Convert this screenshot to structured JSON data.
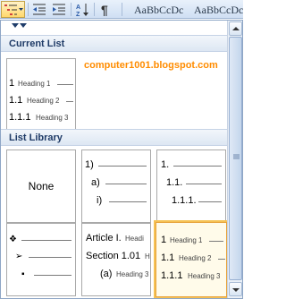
{
  "ribbon": {
    "style_previews": [
      "AaBbCcDc",
      "AaBbCcDc"
    ]
  },
  "popup": {
    "watermark": "computer1001.blogspot.com",
    "current_list": {
      "header": "Current List",
      "tile": {
        "rows": [
          {
            "num": "1",
            "heading": "Heading 1"
          },
          {
            "num": "1.1",
            "heading": "Heading 2"
          },
          {
            "num": "1.1.1",
            "heading": "Heading 3"
          }
        ]
      }
    },
    "list_library": {
      "header": "List Library",
      "none_label": "None",
      "tile_paren": [
        "1)",
        "a)",
        "i)"
      ],
      "tile_decimal": [
        "1.",
        "1.1.",
        "1.1.1."
      ],
      "tile_bullets": [
        "❖",
        "➢",
        "▪"
      ],
      "tile_article": [
        {
          "num": "Article I.",
          "heading": "Headi"
        },
        {
          "num": "Section 1.01",
          "heading": "H"
        },
        {
          "num": "(a)",
          "heading": "Heading 3"
        }
      ],
      "tile_heading": [
        {
          "num": "1",
          "heading": "Heading 1"
        },
        {
          "num": "1.1",
          "heading": "Heading 2"
        },
        {
          "num": "1.1.1",
          "heading": "Heading 3"
        }
      ]
    }
  }
}
